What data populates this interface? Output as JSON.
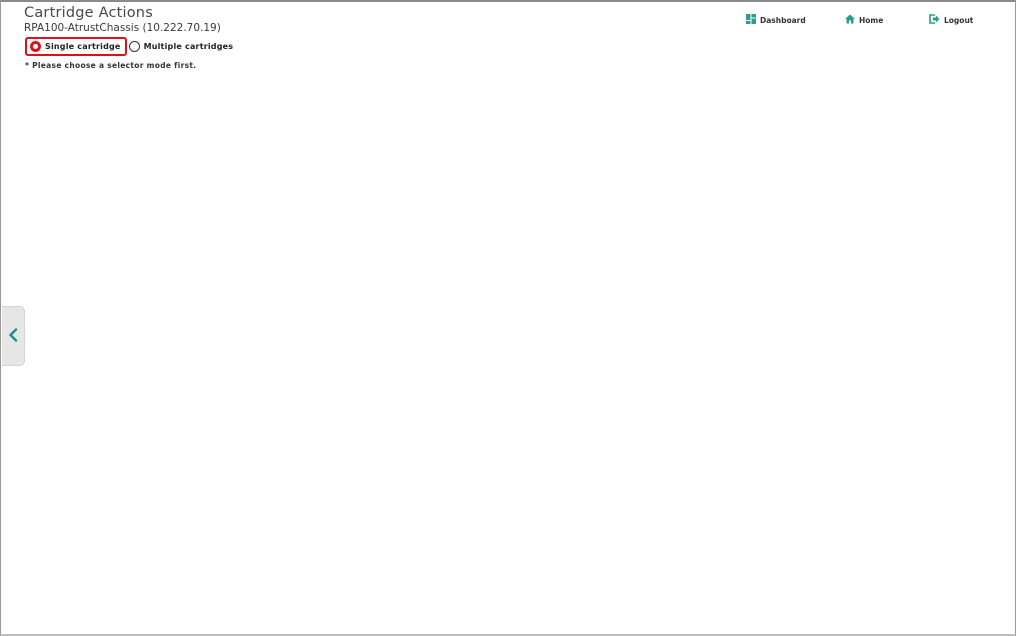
{
  "header": {
    "title": "Cartridge Actions",
    "subtitle": "RPA100-AtrustChassis (10.222.70.19)"
  },
  "selector": {
    "options": [
      {
        "label": "Single cartridge",
        "selected": true
      },
      {
        "label": "Multiple cartridges",
        "selected": false
      }
    ],
    "hint": "* Please choose a selector mode first."
  },
  "nav": {
    "dashboard": "Dashboard",
    "home": "Home",
    "logout": "Logout"
  },
  "colors": {
    "accent": "#2a9d8f",
    "highlight": "#e0101a"
  },
  "icons": {
    "dashboard": "grid-icon",
    "home": "home-icon",
    "logout": "logout-icon",
    "sidebar_toggle": "chevron-left-icon"
  }
}
